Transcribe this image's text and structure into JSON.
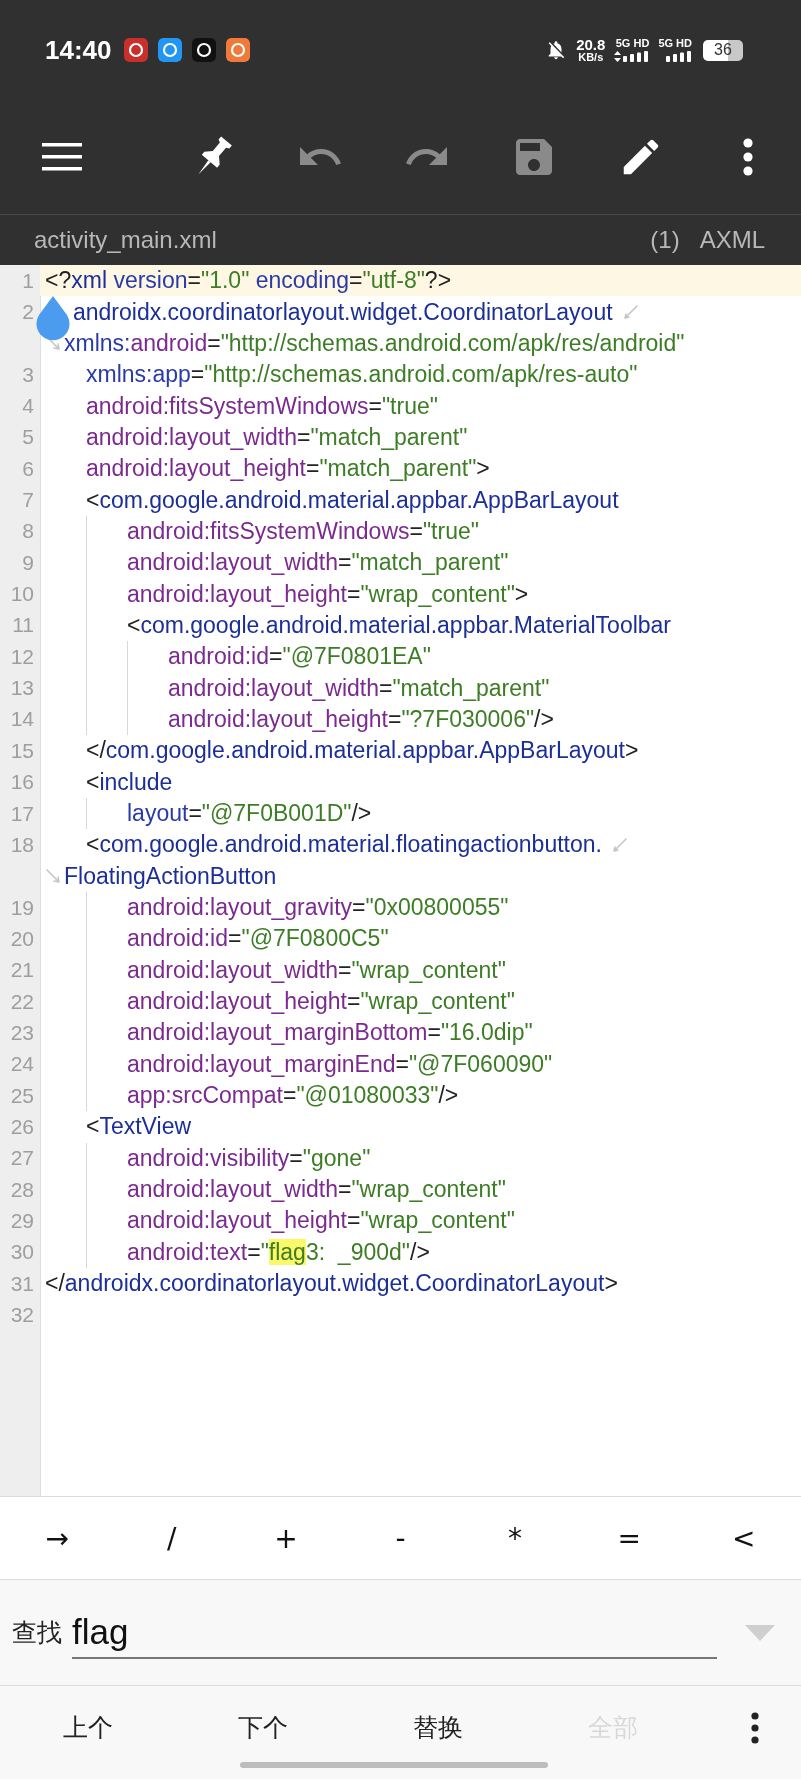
{
  "status_bar": {
    "time": "14:40",
    "notification_icons": [
      {
        "color": "#c9302c"
      },
      {
        "color": "#2196f3"
      },
      {
        "color": "#111111"
      },
      {
        "color": "#f07a3a"
      }
    ],
    "network_speed": {
      "value": "20.8",
      "unit": "KB/s"
    },
    "sims": [
      {
        "label": "5G HD",
        "data_active": true
      },
      {
        "label": "5G HD",
        "data_active": false
      }
    ],
    "battery": "36"
  },
  "toolbar": [
    {
      "kind": "menu",
      "enabled": true
    },
    {
      "kind": "pin",
      "enabled": true
    },
    {
      "kind": "undo",
      "enabled": false
    },
    {
      "kind": "redo",
      "enabled": false
    },
    {
      "kind": "save",
      "enabled": false
    },
    {
      "kind": "edit",
      "enabled": true
    },
    {
      "kind": "more",
      "enabled": true
    }
  ],
  "file_bar": {
    "name": "activity_main.xml",
    "count": "(1)",
    "mode": "AXML"
  },
  "editor": {
    "lines": [
      {
        "number": "1",
        "current": true,
        "rows": [
          [
            {
              "kind": "punct",
              "text": "<?"
            },
            {
              "kind": "tag",
              "text": "xml"
            },
            {
              "kind": "attr",
              "text": " version"
            },
            {
              "kind": "punct",
              "text": "="
            },
            {
              "kind": "value",
              "text": "\"1.0\""
            },
            {
              "kind": "attr",
              "text": " encoding"
            },
            {
              "kind": "punct",
              "text": "="
            },
            {
              "kind": "value",
              "text": "\"utf-8\""
            },
            {
              "kind": "punct",
              "text": "?>"
            }
          ]
        ]
      },
      {
        "number": "2",
        "current": false,
        "cursor_handle": true,
        "rows": [
          [
            {
              "kind": "tag",
              "text": "androidx.coordinatorlayout.widget.CoordinatorLayout"
            }
          ],
          [
            {
              "kind": "attr",
              "text": "xmlns:"
            },
            {
              "kind": "ns_attr",
              "text": "android"
            },
            {
              "kind": "punct",
              "text": "="
            },
            {
              "kind": "value",
              "text": "\"http://schemas.android.com/apk/res/android\""
            }
          ]
        ],
        "children": [
          {
            "number": "3",
            "current": false,
            "rows": [
              [
                {
                  "kind": "attr",
                  "text": "xmlns:app"
                },
                {
                  "kind": "punct",
                  "text": "="
                },
                {
                  "kind": "value",
                  "text": "\"http://schemas.android.com/apk/res-auto\""
                }
              ]
            ]
          },
          {
            "number": "4",
            "current": false,
            "rows": [
              [
                {
                  "kind": "ns_attr",
                  "text": "android:fitsSystemWindows"
                },
                {
                  "kind": "punct",
                  "text": "="
                },
                {
                  "kind": "value",
                  "text": "\"true\""
                }
              ]
            ]
          },
          {
            "number": "5",
            "current": false,
            "rows": [
              [
                {
                  "kind": "ns_attr",
                  "text": "android:layout_width"
                },
                {
                  "kind": "punct",
                  "text": "="
                },
                {
                  "kind": "value",
                  "text": "\"match_parent\""
                }
              ]
            ]
          },
          {
            "number": "6",
            "current": false,
            "rows": [
              [
                {
                  "kind": "ns_attr",
                  "text": "android:layout_height"
                },
                {
                  "kind": "punct",
                  "text": "="
                },
                {
                  "kind": "value",
                  "text": "\"match_parent\""
                },
                {
                  "kind": "punct",
                  "text": ">"
                }
              ]
            ]
          },
          {
            "number": "7",
            "current": false,
            "rows": [
              [
                {
                  "kind": "punct",
                  "text": "<"
                },
                {
                  "kind": "tag",
                  "text": "com.google.android.material.appbar.AppBarLayout"
                }
              ]
            ],
            "children": [
              {
                "number": "8",
                "current": false,
                "rows": [
                  [
                    {
                      "kind": "ns_attr",
                      "text": "android:fitsSystemWindows"
                    },
                    {
                      "kind": "punct",
                      "text": "="
                    },
                    {
                      "kind": "value",
                      "text": "\"true\""
                    }
                  ]
                ]
              },
              {
                "number": "9",
                "current": false,
                "rows": [
                  [
                    {
                      "kind": "ns_attr",
                      "text": "android:layout_width"
                    },
                    {
                      "kind": "punct",
                      "text": "="
                    },
                    {
                      "kind": "value",
                      "text": "\"match_parent\""
                    }
                  ]
                ]
              },
              {
                "number": "10",
                "current": false,
                "rows": [
                  [
                    {
                      "kind": "ns_attr",
                      "text": "android:layout_height"
                    },
                    {
                      "kind": "punct",
                      "text": "="
                    },
                    {
                      "kind": "value",
                      "text": "\"wrap_content\""
                    },
                    {
                      "kind": "punct",
                      "text": ">"
                    }
                  ]
                ]
              },
              {
                "number": "11",
                "current": false,
                "rows": [
                  [
                    {
                      "kind": "punct",
                      "text": "<"
                    },
                    {
                      "kind": "tag",
                      "text": "com.google.android.material.appbar.MaterialToolbar"
                    }
                  ]
                ],
                "children": [
                  {
                    "number": "12",
                    "current": false,
                    "rows": [
                      [
                        {
                          "kind": "ns_attr",
                          "text": "android:id"
                        },
                        {
                          "kind": "punct",
                          "text": "="
                        },
                        {
                          "kind": "value",
                          "text": "\"@7F0801EA\""
                        }
                      ]
                    ]
                  },
                  {
                    "number": "13",
                    "current": false,
                    "rows": [
                      [
                        {
                          "kind": "ns_attr",
                          "text": "android:layout_width"
                        },
                        {
                          "kind": "punct",
                          "text": "="
                        },
                        {
                          "kind": "value",
                          "text": "\"match_parent\""
                        }
                      ]
                    ]
                  },
                  {
                    "number": "14",
                    "current": false,
                    "rows": [
                      [
                        {
                          "kind": "ns_attr",
                          "text": "android:layout_height"
                        },
                        {
                          "kind": "punct",
                          "text": "="
                        },
                        {
                          "kind": "value",
                          "text": "\"?7F030006\""
                        },
                        {
                          "kind": "punct",
                          "text": "/>"
                        }
                      ]
                    ]
                  }
                ]
              }
            ]
          },
          {
            "number": "15",
            "current": false,
            "rows": [
              [
                {
                  "kind": "punct",
                  "text": "</"
                },
                {
                  "kind": "tag",
                  "text": "com.google.android.material.appbar.AppBarLayout"
                },
                {
                  "kind": "punct",
                  "text": ">"
                }
              ]
            ]
          },
          {
            "number": "16",
            "current": false,
            "rows": [
              [
                {
                  "kind": "punct",
                  "text": "<"
                },
                {
                  "kind": "tag",
                  "text": "include"
                }
              ]
            ],
            "children": [
              {
                "number": "17",
                "current": false,
                "rows": [
                  [
                    {
                      "kind": "attr",
                      "text": "layout"
                    },
                    {
                      "kind": "punct",
                      "text": "="
                    },
                    {
                      "kind": "value",
                      "text": "\"@7F0B001D\""
                    },
                    {
                      "kind": "punct",
                      "text": "/>"
                    }
                  ]
                ]
              }
            ]
          },
          {
            "number": "18",
            "current": false,
            "rows": [
              [
                {
                  "kind": "punct",
                  "text": "<"
                },
                {
                  "kind": "tag",
                  "text": "com.google.android.material.floatingactionbutton."
                }
              ],
              [
                {
                  "kind": "tag",
                  "text": "FloatingActionButton"
                }
              ]
            ],
            "children": [
              {
                "number": "19",
                "current": false,
                "rows": [
                  [
                    {
                      "kind": "ns_attr",
                      "text": "android:layout_gravity"
                    },
                    {
                      "kind": "punct",
                      "text": "="
                    },
                    {
                      "kind": "value",
                      "text": "\"0x00800055\""
                    }
                  ]
                ]
              },
              {
                "number": "20",
                "current": false,
                "rows": [
                  [
                    {
                      "kind": "ns_attr",
                      "text": "android:id"
                    },
                    {
                      "kind": "punct",
                      "text": "="
                    },
                    {
                      "kind": "value",
                      "text": "\"@7F0800C5\""
                    }
                  ]
                ]
              },
              {
                "number": "21",
                "current": false,
                "rows": [
                  [
                    {
                      "kind": "ns_attr",
                      "text": "android:layout_width"
                    },
                    {
                      "kind": "punct",
                      "text": "="
                    },
                    {
                      "kind": "value",
                      "text": "\"wrap_content\""
                    }
                  ]
                ]
              },
              {
                "number": "22",
                "current": false,
                "rows": [
                  [
                    {
                      "kind": "ns_attr",
                      "text": "android:layout_height"
                    },
                    {
                      "kind": "punct",
                      "text": "="
                    },
                    {
                      "kind": "value",
                      "text": "\"wrap_content\""
                    }
                  ]
                ]
              },
              {
                "number": "23",
                "current": false,
                "rows": [
                  [
                    {
                      "kind": "ns_attr",
                      "text": "android:layout_marginBottom"
                    },
                    {
                      "kind": "punct",
                      "text": "="
                    },
                    {
                      "kind": "value",
                      "text": "\"16.0dip\""
                    }
                  ]
                ]
              },
              {
                "number": "24",
                "current": false,
                "rows": [
                  [
                    {
                      "kind": "ns_attr",
                      "text": "android:layout_marginEnd"
                    },
                    {
                      "kind": "punct",
                      "text": "="
                    },
                    {
                      "kind": "value",
                      "text": "\"@7F060090\""
                    }
                  ]
                ]
              },
              {
                "number": "25",
                "current": false,
                "rows": [
                  [
                    {
                      "kind": "ns_attr",
                      "text": "app:srcCompat"
                    },
                    {
                      "kind": "punct",
                      "text": "="
                    },
                    {
                      "kind": "value",
                      "text": "\"@01080033\""
                    },
                    {
                      "kind": "punct",
                      "text": "/>"
                    }
                  ]
                ]
              }
            ]
          },
          {
            "number": "26",
            "current": false,
            "rows": [
              [
                {
                  "kind": "punct",
                  "text": "<"
                },
                {
                  "kind": "tag",
                  "text": "TextView"
                }
              ]
            ],
            "children": [
              {
                "number": "27",
                "current": false,
                "rows": [
                  [
                    {
                      "kind": "ns_attr",
                      "text": "android:visibility"
                    },
                    {
                      "kind": "punct",
                      "text": "="
                    },
                    {
                      "kind": "value",
                      "text": "\"gone\""
                    }
                  ]
                ]
              },
              {
                "number": "28",
                "current": false,
                "rows": [
                  [
                    {
                      "kind": "ns_attr",
                      "text": "android:layout_width"
                    },
                    {
                      "kind": "punct",
                      "text": "="
                    },
                    {
                      "kind": "value",
                      "text": "\"wrap_content\""
                    }
                  ]
                ]
              },
              {
                "number": "29",
                "current": false,
                "rows": [
                  [
                    {
                      "kind": "ns_attr",
                      "text": "android:layout_height"
                    },
                    {
                      "kind": "punct",
                      "text": "="
                    },
                    {
                      "kind": "value",
                      "text": "\"wrap_content\""
                    }
                  ]
                ]
              },
              {
                "number": "30",
                "current": false,
                "rows": [
                  [
                    {
                      "kind": "ns_attr",
                      "text": "android:text"
                    },
                    {
                      "kind": "punct",
                      "text": "="
                    },
                    {
                      "kind": "value",
                      "text": "\""
                    },
                    {
                      "kind": "match",
                      "text": "flag"
                    },
                    {
                      "kind": "value",
                      "text": "3:  _900d\""
                    },
                    {
                      "kind": "punct",
                      "text": "/>"
                    }
                  ]
                ]
              }
            ]
          }
        ]
      },
      {
        "number": "31",
        "current": false,
        "rows": [
          [
            {
              "kind": "punct",
              "text": "</"
            },
            {
              "kind": "tag",
              "text": "androidx.coordinatorlayout.widget.CoordinatorLayout"
            },
            {
              "kind": "punct",
              "text": ">"
            }
          ]
        ]
      },
      {
        "number": "32",
        "current": false
      }
    ]
  },
  "symbol_keys": [
    "→",
    "/",
    "+",
    "-",
    "*",
    "=",
    "<"
  ],
  "search": {
    "label": "查找",
    "value": "flag"
  },
  "actions": [
    {
      "label": "上个",
      "disabled": false
    },
    {
      "label": "下个",
      "disabled": false
    },
    {
      "label": "替换",
      "disabled": false
    },
    {
      "label": "全部",
      "disabled": true
    }
  ]
}
